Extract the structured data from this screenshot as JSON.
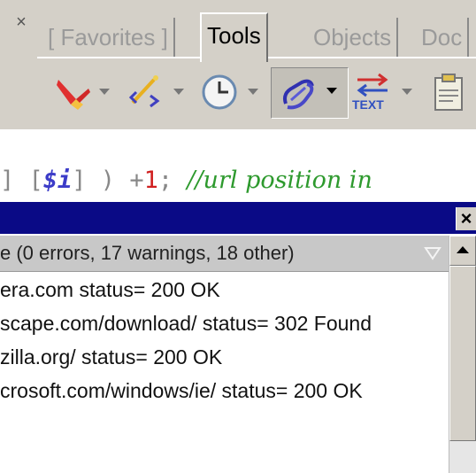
{
  "toolbar": {
    "close_glyph": "×",
    "tabs": [
      {
        "label": "[ Favorites ]",
        "active": false
      },
      {
        "label": "Tools",
        "active": true
      },
      {
        "label": "Objects",
        "active": false
      },
      {
        "label": "Doc",
        "active": false
      }
    ],
    "tools": [
      {
        "icon": "highlighter-icon"
      },
      {
        "icon": "tag-wand-icon"
      },
      {
        "icon": "clock-icon"
      },
      {
        "icon": "link-icon",
        "pressed": true
      },
      {
        "icon": "text-convert-icon",
        "caption": "TEXT"
      },
      {
        "icon": "clipboard-icon"
      }
    ]
  },
  "code": {
    "prefix": "] [",
    "var": "$i",
    "mid": "] ) +",
    "num": "1",
    "semi": "; ",
    "comment": "//url position in"
  },
  "output": {
    "title_close": "×",
    "summary": "e  (0 errors, 17 warnings, 18 other)",
    "lines": [
      "era.com status= 200 OK",
      "scape.com/download/ status= 302 Found",
      "zilla.org/ status= 200 OK",
      "crosoft.com/windows/ie/ status= 200 OK"
    ]
  },
  "colors": {
    "title_bar": "#0a0a86",
    "panel": "#d4d0c8",
    "comment": "#2e9a2e",
    "number": "#d02020",
    "variable": "#3c3cc8"
  }
}
